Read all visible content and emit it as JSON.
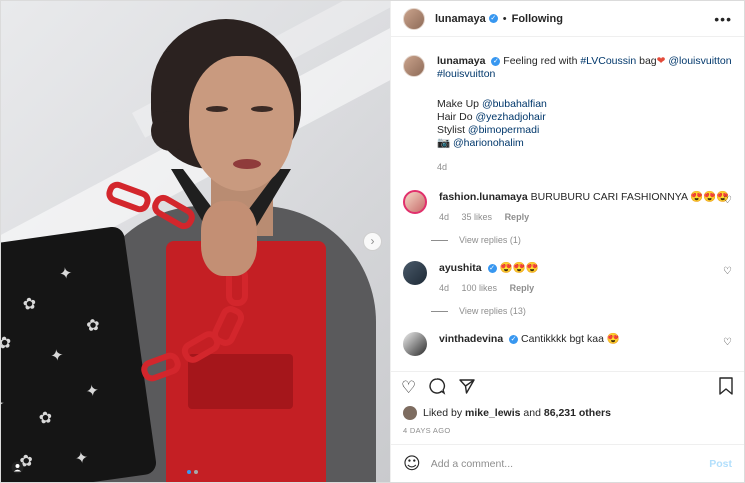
{
  "post_author": {
    "username": "lunamaya",
    "follow_status": "Following"
  },
  "caption": {
    "username": "lunamaya",
    "text_before": "Feeling red with ",
    "hashtag1": "#LVCoussin",
    "text_bag": " bag",
    "emoji_heart": "❤",
    "mention1": "@louisvuitton",
    "hashtag2": "#louisvuitton",
    "credit_makeup_label": "Make Up ",
    "credit_makeup": "@bubahalfian",
    "credit_hair_label": "Hair Do ",
    "credit_hair": "@yezhadjohair",
    "credit_stylist_label": "Stylist ",
    "credit_stylist": "@bimopermadi",
    "credit_camera_icon": "📷",
    "credit_photo": "@harionohalim",
    "time": "4d"
  },
  "comments": [
    {
      "username": "fashion.lunamaya",
      "text": "BURUBURU CARI FASHIONNYA 😍😍😍",
      "time": "4d",
      "likes": "35 likes",
      "reply_label": "Reply",
      "view_replies": "View replies (1)"
    },
    {
      "username": "ayushita",
      "text": "😍😍😍",
      "time": "4d",
      "likes": "100 likes",
      "reply_label": "Reply",
      "view_replies": "View replies (13)"
    },
    {
      "username": "vinthadevina",
      "text": "Cantikkkk bgt kaa 😍"
    }
  ],
  "liked_by": {
    "prefix": "Liked by ",
    "user": "mike_lewis",
    "middle": " and ",
    "count": "86,231 others"
  },
  "timestamp": "4 DAYS AGO",
  "comment_input": {
    "placeholder": "Add a comment...",
    "post_label": "Post"
  },
  "icons": {
    "more": "more-icon",
    "heart": "heart-icon",
    "comment": "comment-icon",
    "share": "share-icon",
    "bookmark": "bookmark-icon",
    "emoji": "emoji-icon",
    "next": "chevron-right-icon"
  },
  "colors": {
    "accent": "#3897f0",
    "link": "#00376b",
    "muted": "#8e8e8e",
    "vest_red": "#c41f24"
  },
  "carousel": {
    "slides": 2,
    "active": 1
  }
}
